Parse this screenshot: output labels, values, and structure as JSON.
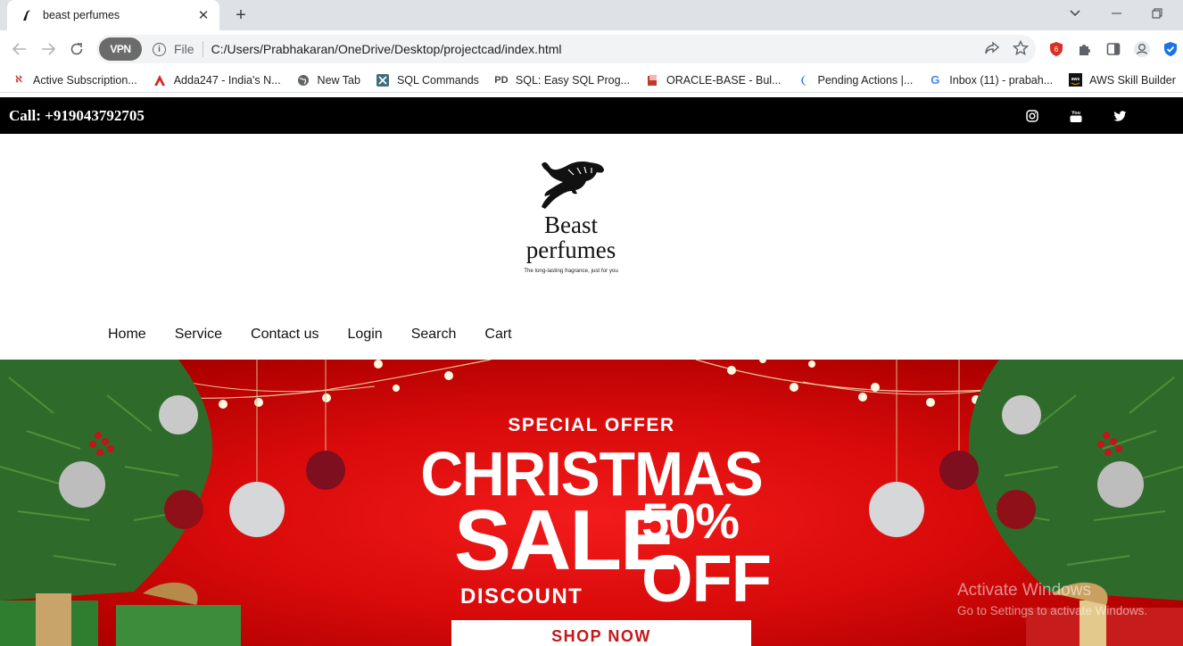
{
  "browser": {
    "tab_title": "beast perfumes",
    "address_scheme_label": "File",
    "url": "C:/Users/Prabhakaran/OneDrive/Desktop/projectcad/index.html",
    "vpn_label": "VPN",
    "bookmarks": [
      {
        "label": "Active Subscription..."
      },
      {
        "label": "Adda247 - India's N..."
      },
      {
        "label": "New Tab"
      },
      {
        "label": "SQL Commands"
      },
      {
        "label": "SQL: Easy SQL Prog..."
      },
      {
        "label": "ORACLE-BASE - Bul..."
      },
      {
        "label": "Pending Actions |..."
      },
      {
        "label": "Inbox (11) - prabah..."
      },
      {
        "label": "AWS Skill Builder"
      }
    ]
  },
  "site": {
    "call_text": "Call: +919043792705",
    "brand_line1": "Beast",
    "brand_line2": "perfumes",
    "tagline": "The long-lasting fragrance, just for you",
    "nav": [
      "Home",
      "Service",
      "Contact us",
      "Login",
      "Search",
      "Cart"
    ],
    "hero": {
      "special_offer": "SPECIAL OFFER",
      "christmas": "CHRISTMAS",
      "sale": "SALE",
      "percent": "50%",
      "off": "OFF",
      "discount": "DISCOUNT",
      "shop_now": "SHOP NOW"
    }
  },
  "os": {
    "watermark_title": "Activate Windows",
    "watermark_sub": "Go to Settings to activate Windows."
  }
}
